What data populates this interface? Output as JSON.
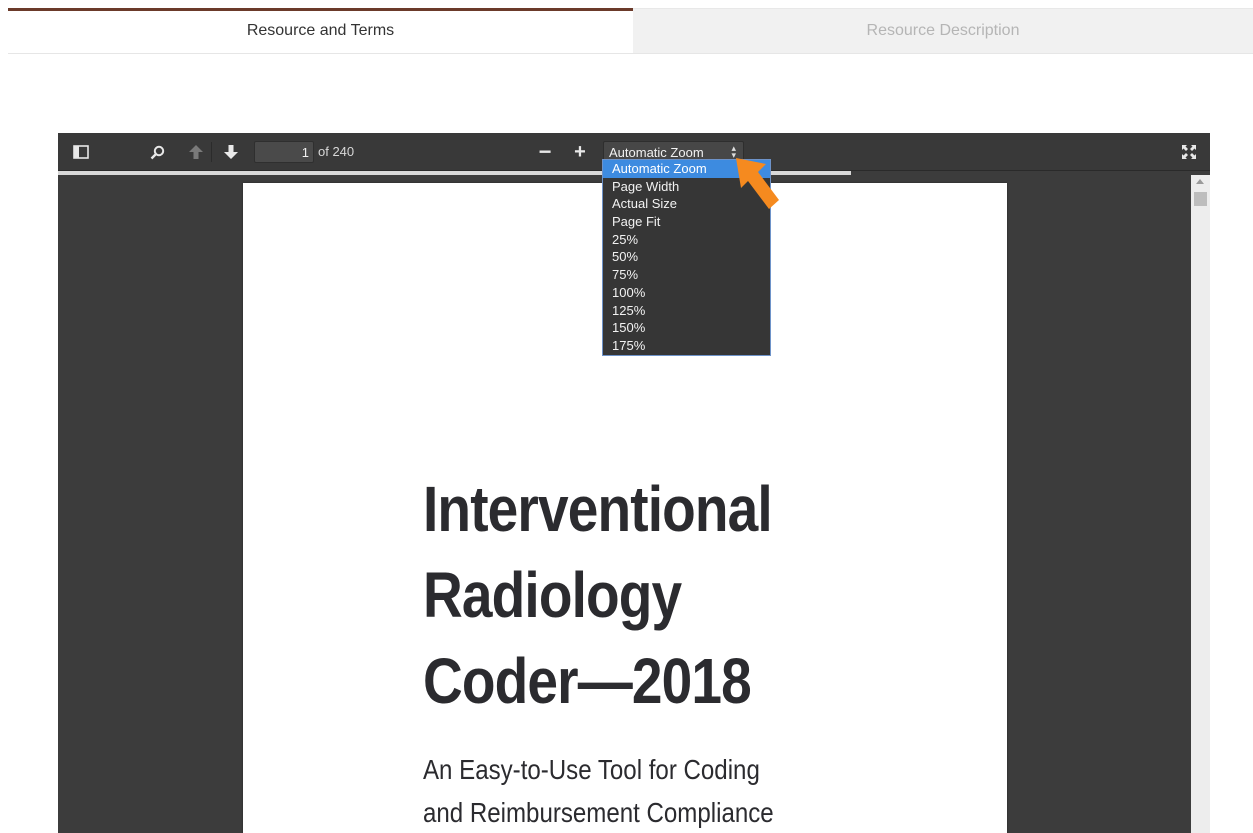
{
  "tabs": [
    {
      "label": "Resource and Terms",
      "active": true
    },
    {
      "label": "Resource Description",
      "active": false
    }
  ],
  "toolbar": {
    "sidebar_toggle_icon": "sidebar-toggle-icon",
    "search_icon": "search-icon",
    "prev_icon": "arrow-up-icon",
    "next_icon": "arrow-down-icon",
    "page_number": "1",
    "page_count_text": "of 240",
    "zoom_out_label": "−",
    "zoom_in_label": "+",
    "zoom_selected": "Automatic Zoom",
    "fullscreen_icon": "fullscreen-icon"
  },
  "zoom_options": [
    "Automatic Zoom",
    "Page Width",
    "Actual Size",
    "Page Fit",
    "25%",
    "50%",
    "75%",
    "100%",
    "125%",
    "150%",
    "175%"
  ],
  "document": {
    "title_lines": [
      "Interventional",
      "Radiology",
      "Coder—2018"
    ],
    "subtitle_lines": [
      "An Easy-to-Use Tool for Coding",
      "and Reimbursement Compliance"
    ]
  },
  "colors": {
    "active_tab_border": "#6b3a2a",
    "selected_option": "#3d8be0",
    "annotation_arrow": "#f58a1f"
  }
}
